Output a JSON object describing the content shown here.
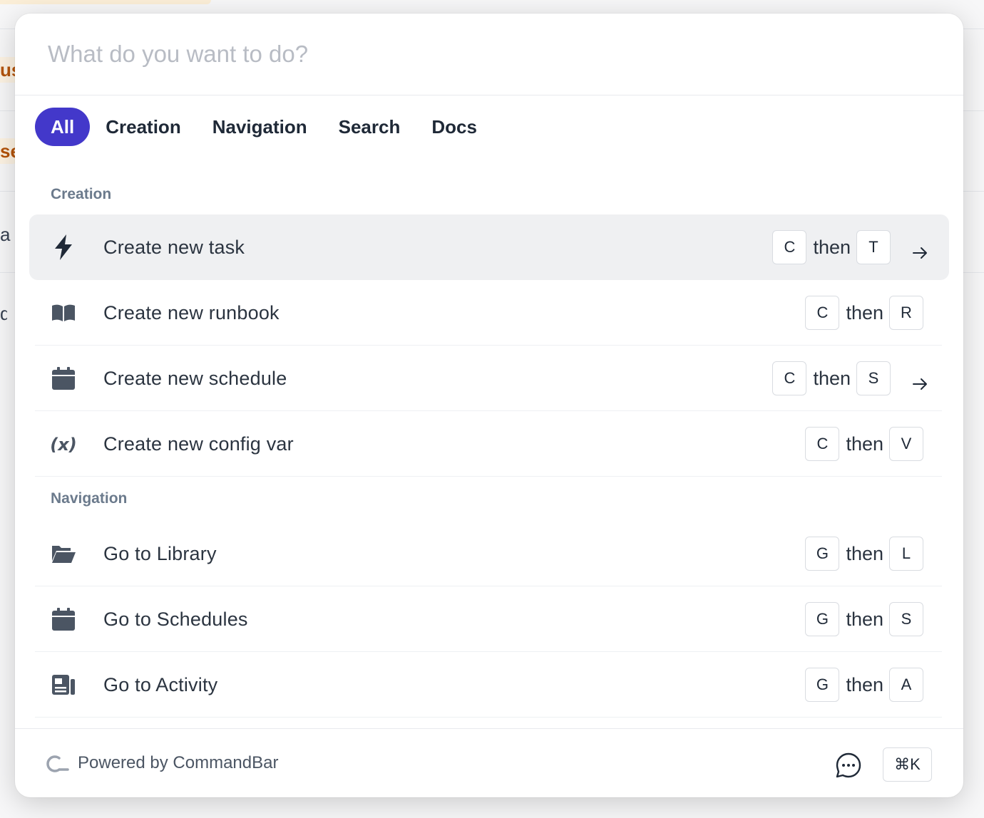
{
  "background": {
    "chip_fragments": [
      "us",
      "se"
    ],
    "text_fragments": [
      "a r",
      "d"
    ]
  },
  "search": {
    "placeholder": "What do you want to do?"
  },
  "tabs": [
    {
      "label": "All",
      "active": true
    },
    {
      "label": "Creation"
    },
    {
      "label": "Navigation"
    },
    {
      "label": "Search"
    },
    {
      "label": "Docs"
    }
  ],
  "sections": {
    "creation": {
      "label": "Creation",
      "items": [
        {
          "icon": "lightning-bolt-icon",
          "label": "Create new task",
          "keys": [
            "C",
            "T"
          ],
          "arrow": true,
          "active": true
        },
        {
          "icon": "open-book-icon",
          "label": "Create new runbook",
          "keys": [
            "C",
            "R"
          ]
        },
        {
          "icon": "calendar-icon",
          "label": "Create new schedule",
          "keys": [
            "C",
            "S"
          ],
          "arrow": true
        },
        {
          "icon": "variable-x-icon",
          "label": "Create new config var",
          "keys": [
            "C",
            "V"
          ]
        }
      ]
    },
    "navigation": {
      "label": "Navigation",
      "items": [
        {
          "icon": "folder-open-icon",
          "label": "Go to Library",
          "keys": [
            "G",
            "L"
          ]
        },
        {
          "icon": "calendar-icon",
          "label": "Go to Schedules",
          "keys": [
            "G",
            "S"
          ]
        },
        {
          "icon": "activity-feed-icon",
          "label": "Go to Activity",
          "keys": [
            "G",
            "A"
          ]
        }
      ]
    }
  },
  "then_label": "then",
  "footer": {
    "powered_by": "Powered by CommandBar",
    "shortcut": "⌘K"
  },
  "colors": {
    "accent": "#4338ca",
    "icon": "#4b5563",
    "active_row": "#eff0f2"
  }
}
